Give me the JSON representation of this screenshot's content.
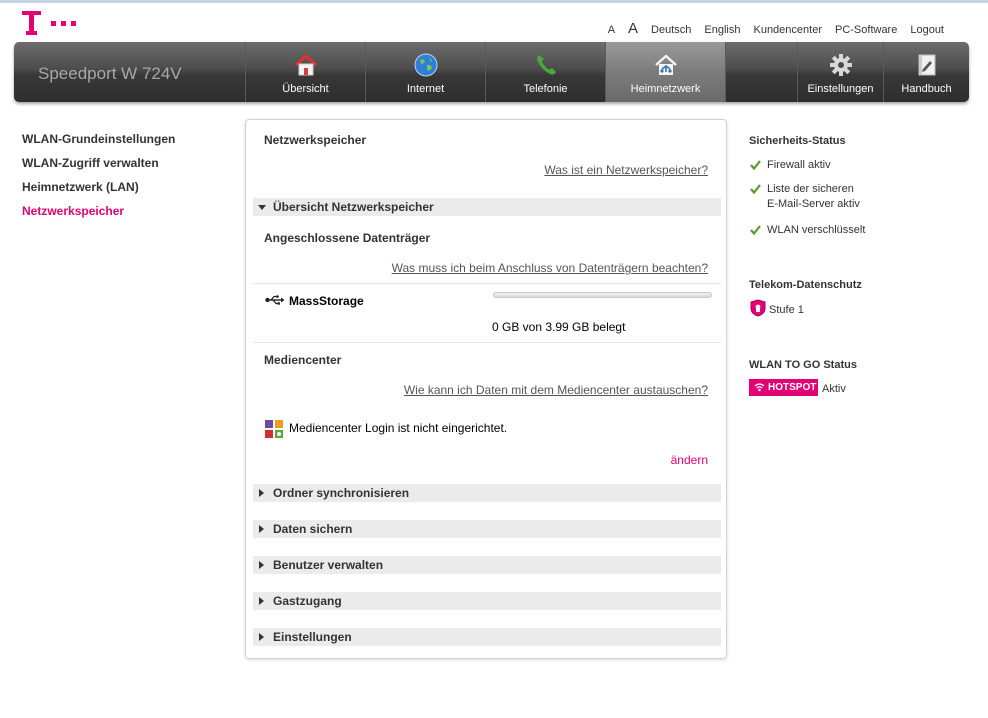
{
  "header": {
    "font_small": "A",
    "font_large": "A",
    "links": [
      "Deutsch",
      "English",
      "Kundencenter",
      "PC-Software",
      "Logout"
    ]
  },
  "brand": "Speedport W 724V",
  "nav": [
    {
      "label": "Übersicht",
      "icon": "house-icon"
    },
    {
      "label": "Internet",
      "icon": "globe-icon"
    },
    {
      "label": "Telefonie",
      "icon": "phone-icon"
    },
    {
      "label": "Heimnetzwerk",
      "icon": "home-network-icon",
      "active": true
    },
    {
      "label": "Einstellungen",
      "icon": "gear-icon"
    },
    {
      "label": "Handbuch",
      "icon": "manual-icon"
    }
  ],
  "sidebar": {
    "items": [
      {
        "label": "WLAN-Grundeinstellungen"
      },
      {
        "label": "WLAN-Zugriff verwalten"
      },
      {
        "label": "Heimnetzwerk (LAN)"
      },
      {
        "label": "Netzwerkspeicher",
        "active": true
      }
    ]
  },
  "main": {
    "title": "Netzwerkspeicher",
    "help_link": "Was ist ein Netzwerkspeicher?",
    "overview_section": "Übersicht Netzwerkspeicher",
    "drives_title": "Angeschlossene Datenträger",
    "drives_help_link": "Was muss ich beim Anschluss von Datenträgern beachten?",
    "storage": {
      "name": "MassStorage",
      "usage_text": "0 GB von 3.99 GB belegt",
      "used_fraction": 0.0
    },
    "mediacenter_title": "Mediencenter",
    "mediacenter_help_link": "Wie kann ich Daten mit dem Mediencenter austauschen?",
    "mediacenter_status": "Mediencenter Login ist nicht eingerichtet.",
    "change_link": "ändern",
    "sections": [
      "Ordner synchronisieren",
      "Daten sichern",
      "Benutzer verwalten",
      "Gastzugang",
      "Einstellungen"
    ]
  },
  "security": {
    "title": "Sicherheits-Status",
    "items": [
      "Firewall aktiv",
      "Liste der sicheren",
      "E-Mail-Server aktiv",
      "WLAN verschlüsselt"
    ]
  },
  "privacy": {
    "title": "Telekom-Datenschutz",
    "level": "Stufe 1"
  },
  "wlan_to_go": {
    "title": "WLAN TO GO Status",
    "badge": "HOTSPOT",
    "status": "Aktiv"
  },
  "colors": {
    "accent": "#e20074",
    "nav_dark": "#3a3a3a",
    "check_green": "#5a9a2a"
  }
}
